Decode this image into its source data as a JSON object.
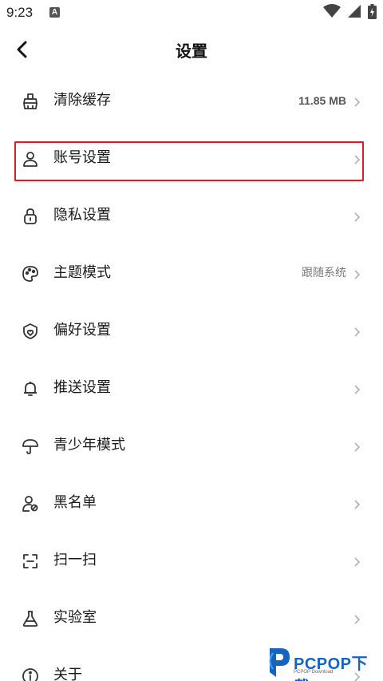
{
  "status_bar": {
    "time": "9:23",
    "notif_badge": "A"
  },
  "header": {
    "title": "设置"
  },
  "settings": [
    {
      "icon": "broom-icon",
      "label": "清除缓存",
      "value": "11.85 MB"
    },
    {
      "icon": "person-icon",
      "label": "账号设置",
      "value": ""
    },
    {
      "icon": "lock-icon",
      "label": "隐私设置",
      "value": ""
    },
    {
      "icon": "palette-icon",
      "label": "主题模式",
      "value": "跟随系统"
    },
    {
      "icon": "shield-heart-icon",
      "label": "偏好设置",
      "value": ""
    },
    {
      "icon": "bell-icon",
      "label": "推送设置",
      "value": ""
    },
    {
      "icon": "umbrella-icon",
      "label": "青少年模式",
      "value": ""
    },
    {
      "icon": "person-block-icon",
      "label": "黑名单",
      "value": ""
    },
    {
      "icon": "scan-icon",
      "label": "扫一扫",
      "value": ""
    },
    {
      "icon": "flask-icon",
      "label": "实验室",
      "value": ""
    },
    {
      "icon": "info-icon",
      "label": "关于",
      "value": ""
    }
  ],
  "watermark": {
    "brand": "PCPOP下载",
    "sub": "PCPOP Download"
  },
  "colors": {
    "highlight": "#d81e28",
    "watermark": "#1565c0"
  }
}
